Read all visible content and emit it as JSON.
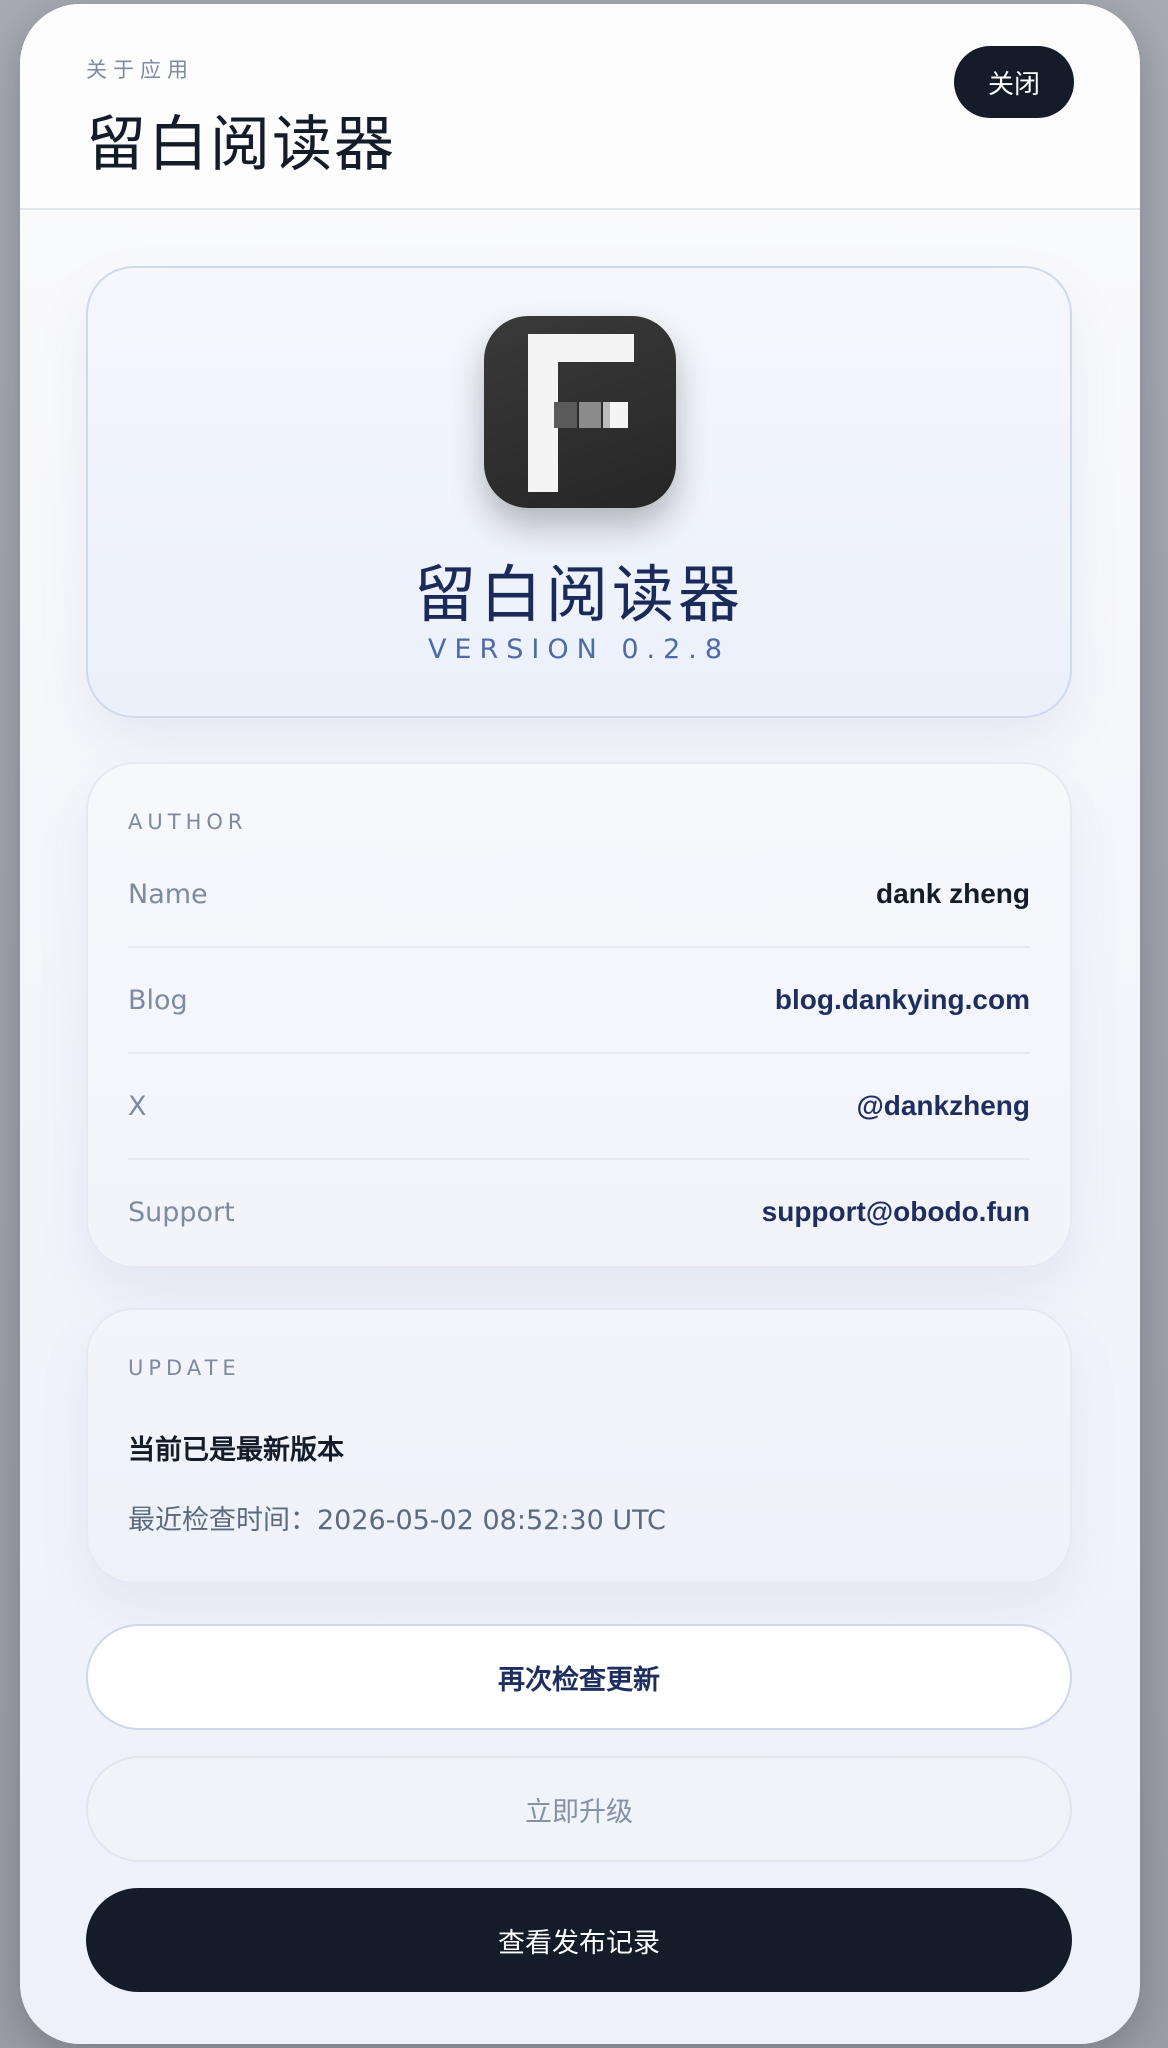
{
  "header": {
    "eyebrow": "关于应用",
    "title": "留白阅读器",
    "close_label": "关闭"
  },
  "app": {
    "name": "留白阅读器",
    "version": "VERSION 0.2.8",
    "icon": "app-logo-icon"
  },
  "author": {
    "section_label": "AUTHOR",
    "rows": [
      {
        "label": "Name",
        "value": "dank zheng"
      },
      {
        "label": "Blog",
        "value": "blog.dankying.com"
      },
      {
        "label": "X",
        "value": "@dankzheng"
      },
      {
        "label": "Support",
        "value": "support@obodo.fun"
      }
    ]
  },
  "update": {
    "section_label": "UPDATE",
    "status": "当前已是最新版本",
    "last_checked": "最近检查时间：2026-05-02 08:52:30 UTC"
  },
  "actions": {
    "check_again": "再次检查更新",
    "upgrade_now": "立即升级",
    "view_releases": "查看发布记录"
  },
  "colors": {
    "primary_dark": "#141c29",
    "accent_navy": "#1f2e5e",
    "muted_label": "#7d8aa0"
  }
}
